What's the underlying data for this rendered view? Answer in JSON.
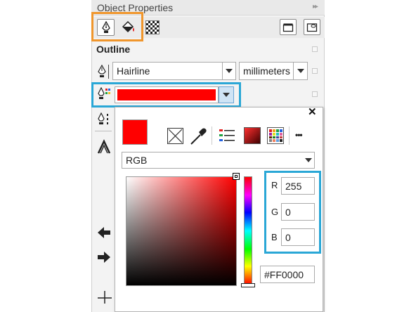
{
  "panel": {
    "title": "Object Properties",
    "expand_label": "▸▸",
    "section_title": "Outline"
  },
  "outline": {
    "width_value": "Hairline",
    "units_value": "millimeters",
    "color_hex": "#FF0000"
  },
  "color_picker": {
    "close_label": "✕",
    "model_value": "RGB",
    "r_label": "R",
    "g_label": "G",
    "b_label": "B",
    "r_value": "255",
    "g_value": "0",
    "b_value": "0",
    "hex_value": "#FF0000",
    "more_label": "•••"
  },
  "colors": {
    "highlight_orange": "#f0962c",
    "highlight_blue": "#2aa7d6",
    "selected_red": "#ff0000"
  }
}
